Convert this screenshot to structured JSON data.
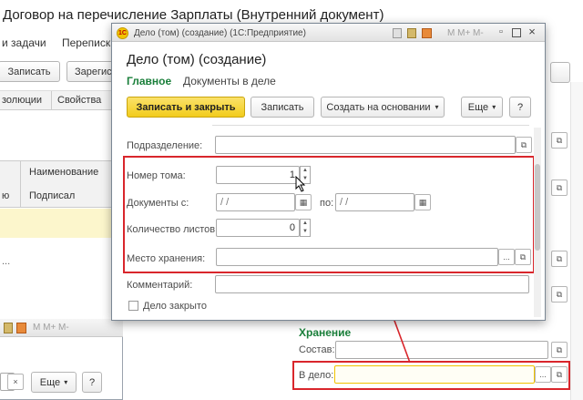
{
  "bg": {
    "title": "Договор на перечисление Зарплаты (Внутренний документ)",
    "nav_tasks": "и задачи",
    "nav_correspondence": "Переписка",
    "btn_save": "Записать",
    "btn_register": "Зарегис",
    "tab_resolutions": "золюции",
    "tab_properties": "Свойства",
    "col_name": "Наименование",
    "col_signed": "Подписал",
    "left_frag": "ю",
    "dots": "...",
    "storage_title": "Хранение",
    "composition_label": "Состав:",
    "in_case_label": "В дело:",
    "mini_more": "Еще",
    "mini_help": "?",
    "mini_close": "×",
    "mini_toolbar": "M  M+  M-"
  },
  "dialog": {
    "window_title": "Дело (том) (создание)  (1С:Предприятие)",
    "toolbar_memory": "M  M+  M-",
    "heading": "Дело (том) (создание)",
    "tab_main": "Главное",
    "tab_docs": "Документы в деле",
    "btn_save_close": "Записать и закрыть",
    "btn_save": "Записать",
    "btn_create_based": "Создать на основании",
    "btn_more": "Еще",
    "btn_help": "?",
    "dept_label": "Подразделение:",
    "volume_label": "Номер тома:",
    "volume_value": "1",
    "docs_from_label": "Документы с:",
    "date_placeholder": "  /  /",
    "to_label": "по:",
    "sheets_label": "Количество листов:",
    "sheets_value": "0",
    "storage_label": "Место хранения:",
    "comment_label": "Комментарий:",
    "closed_label": "Дело закрыто",
    "dots": "..."
  },
  "colors": {
    "accent_green": "#1a7f3a",
    "highlight_red": "#d9262c",
    "primary_yellow": "#f6d531",
    "storage_yellow": "#f0c300"
  }
}
